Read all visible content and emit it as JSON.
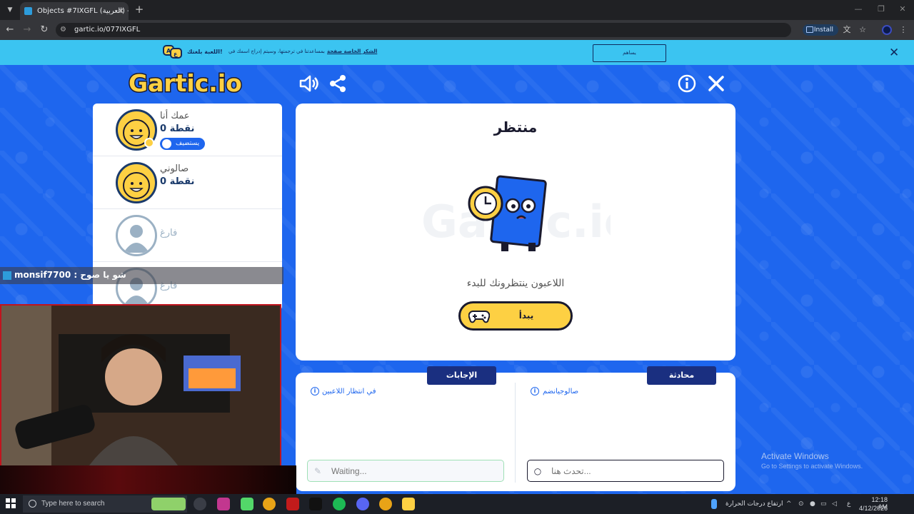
{
  "browser": {
    "tab_title": "Objects #7IXGFL (العربية) - Gartic",
    "url": "gartic.io/077IXGFL",
    "install_label": "Install"
  },
  "banner": {
    "title": "اللعبة بلغتك!",
    "text": "بمساعدتنا في ترجمتها، وسيتم إدراج اسمك في",
    "link": "الشكر الخاصة صفحة",
    "button": "يساهم"
  },
  "game": {
    "logo_text": "Gartic.io",
    "players": [
      {
        "name": "عمك أنا",
        "score": "0 نقطة",
        "badge": "يستضيف",
        "empty": false
      },
      {
        "name": "صالوني",
        "score": "0 نقطة",
        "empty": false
      },
      {
        "name": "فارغ",
        "empty": true
      },
      {
        "name": "فارغ",
        "empty": true
      }
    ],
    "waiting_title": "منتظر",
    "waiting_message": "اللاعبون ينتظرونك للبدء",
    "start_label": "يبدأ",
    "answers_tab": "الإجابات",
    "chat_tab": "محادثة",
    "answers_note": "في انتظار اللاعبين",
    "chat_note": "صالوجيانضم",
    "answer_placeholder": "Waiting...",
    "chat_placeholder": "تحدث هنا..."
  },
  "stream": {
    "overlay_message": "monsif7700 : شو يا صوح"
  },
  "watermark": {
    "title": "Activate Windows",
    "subtitle": "Go to Settings to activate Windows."
  },
  "taskbar": {
    "search_placeholder": "Type here to search",
    "weather_text": "ارتفاع درجات الحرارة",
    "lang": "ع",
    "time": "12:18 AM",
    "date": "4/12/2026"
  },
  "colors": {
    "game_bg": "#1e66ee",
    "banner_bg": "#3bc4f1",
    "accent_yellow": "#fdd043",
    "tab_navy": "#1a2f80"
  }
}
